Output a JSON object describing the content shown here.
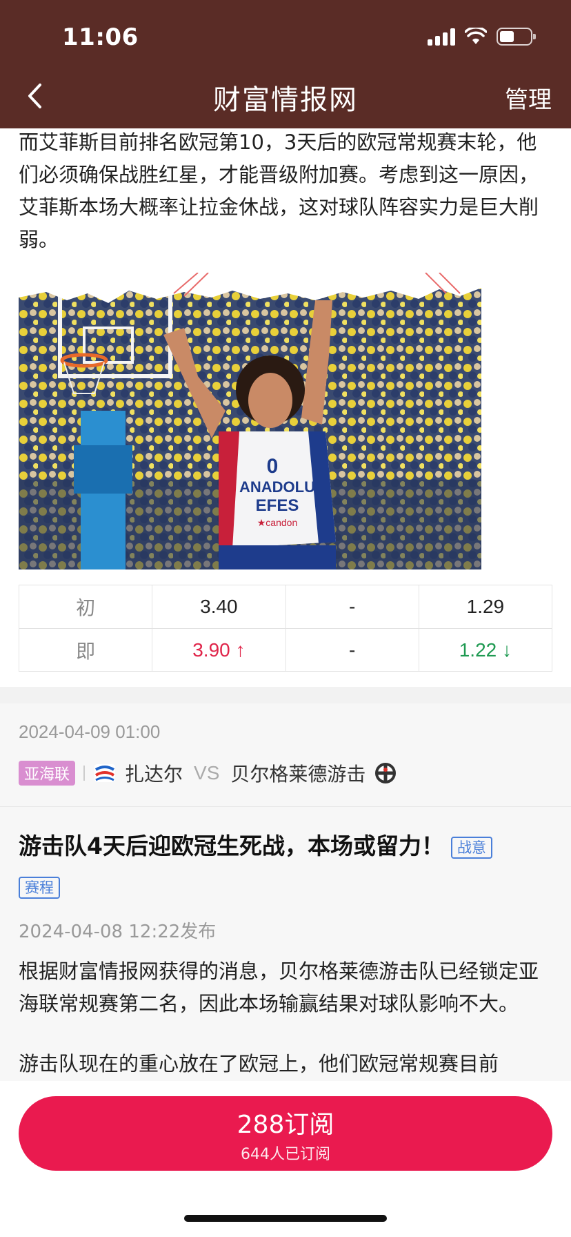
{
  "status_bar": {
    "time": "11:06"
  },
  "nav": {
    "title": "财富情报网",
    "manage_label": "管理"
  },
  "article1": {
    "text": "而艾菲斯目前排名欧冠第10，3天后的欧冠常规赛末轮，他们必须确保战胜红星，才能晋级附加赛。考虑到这一原因，艾菲斯本场大概率让拉金休战，这对球队阵容实力是巨大削弱。",
    "photo_text": {
      "jersey_line1": "ANADOLU",
      "jersey_line2": "EFES",
      "jersey_line3": "★candon",
      "number": "0"
    }
  },
  "odds": {
    "rows": [
      {
        "label": "初",
        "home": "3.40",
        "draw": "-",
        "away": "1.29",
        "home_trend": "",
        "away_trend": ""
      },
      {
        "label": "即",
        "home": "3.90 ↑",
        "draw": "-",
        "away": "1.22 ↓",
        "home_trend": "up",
        "away_trend": "down"
      }
    ]
  },
  "match": {
    "datetime": "2024-04-09 01:00",
    "league": "亚海联",
    "home_team": "扎达尔",
    "vs": "VS",
    "away_team": "贝尔格莱德游击",
    "league_color": "#d98ed0"
  },
  "article2": {
    "title": "游击队4天后迎欧冠生死战，本场或留力！",
    "tags": [
      "战意",
      "赛程"
    ],
    "published": "2024-04-08 12:22发布",
    "paragraph1": "根据财富情报网获得的消息，贝尔格莱德游击队已经锁定亚海联常规赛第二名，因此本场输赢结果对球队影响不大。",
    "paragraph2": "游击队现在的重心放在了欧冠上，他们欧冠常规赛目前"
  },
  "subscribe": {
    "price_label": "288订阅",
    "count_label": "644人已订阅",
    "color": "#ea1a4f"
  },
  "colors": {
    "header_bg": "#5a2c26",
    "up": "#e0254a",
    "down": "#1f9a52",
    "tag": "#4a7fd9"
  }
}
